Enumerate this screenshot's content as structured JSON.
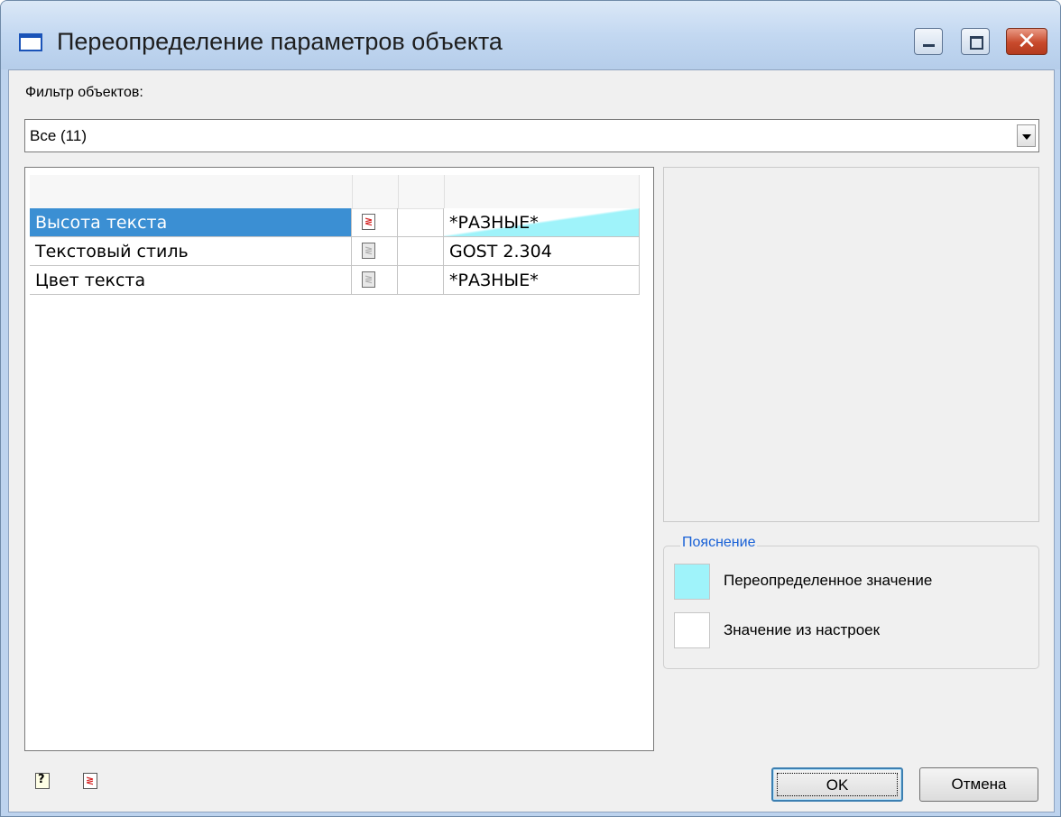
{
  "window": {
    "title": "Переопределение параметров объекта",
    "title_icon": "window-icon",
    "controls": [
      "minimize-icon",
      "maximize-icon",
      "close-icon"
    ]
  },
  "filter": {
    "label": "Фильтр объектов:",
    "selected": "Все (11)"
  },
  "grid": {
    "rows": [
      {
        "name": "Высота текста",
        "value": "*РАЗНЫЕ*",
        "selected": true,
        "overridden": true,
        "icon_active": true
      },
      {
        "name": "Текстовый стиль",
        "value": "GOST 2.304",
        "selected": false,
        "overridden": false,
        "icon_active": false
      },
      {
        "name": "Цвет текста",
        "value": "*РАЗНЫЕ*",
        "selected": false,
        "overridden": false,
        "icon_active": false
      }
    ]
  },
  "legend": {
    "title": "Пояснение",
    "items": [
      {
        "label": "Переопределенное значение",
        "color": "#9ff3fa"
      },
      {
        "label": "Значение из настроек",
        "color": "#ffffff"
      }
    ]
  },
  "buttons": {
    "ok": "OK",
    "cancel": "Отмена"
  },
  "bottom_icons": [
    "help-icon",
    "refresh-icon"
  ],
  "colors": {
    "selection": "#3b8fd3",
    "override": "#9ff3fa",
    "legend_title": "#1760d6"
  }
}
